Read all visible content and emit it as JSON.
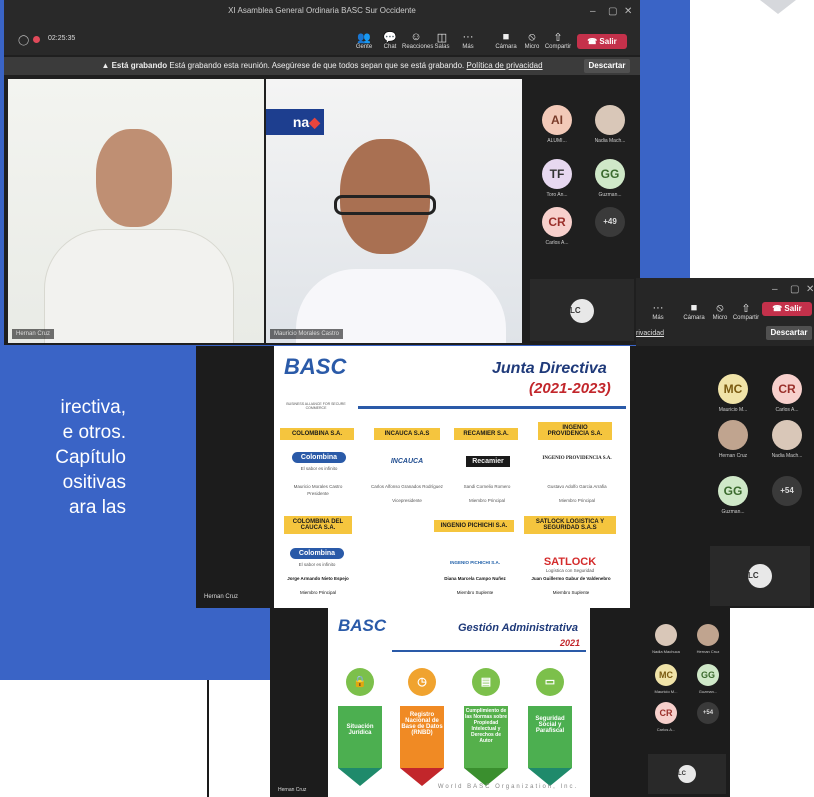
{
  "meeting": {
    "title": "XI Asamblea General Ordinaria BASC Sur Occidente",
    "timer": "02:25:35",
    "tools": [
      "Gente",
      "Chat",
      "Reacciones",
      "Salas",
      "Más",
      "Cámara",
      "Micro",
      "Compartir"
    ],
    "leave": "Salir",
    "banner_strong": "Está grabando",
    "banner_text": "Está grabando esta reunión. Asegúrese de que todos sepan que se está grabando.",
    "banner_link": "Política de privacidad",
    "dismiss": "Descartar"
  },
  "win1": {
    "video1_name": "Hernan Cruz",
    "video2_name": "Mauricio Morales Castro",
    "participants": [
      {
        "initials": "AI",
        "label": "ALUMI..."
      },
      {
        "initials": "",
        "label": "Nadia Mach..."
      },
      {
        "initials": "TF",
        "label": "Toro An..."
      },
      {
        "initials": "GG",
        "label": "Guzman..."
      },
      {
        "initials": "CR",
        "label": "Carlos A..."
      },
      {
        "initials": "+49",
        "label": ""
      }
    ],
    "self": "LC"
  },
  "win2": {
    "tools": [
      "Más",
      "Cámara",
      "Micro",
      "Compartir"
    ],
    "leave": "Salir",
    "privacy_fragment": "rivacidad",
    "dismiss": "Descartar",
    "name": "Hernan Cruz",
    "participants": [
      {
        "initials": "MC",
        "label": "Mauricio M..."
      },
      {
        "initials": "CR",
        "label": "Carlos A..."
      },
      {
        "initials": "",
        "label": "Hernan Cruz"
      },
      {
        "initials": "",
        "label": "Nadia Mach..."
      },
      {
        "initials": "GG",
        "label": "Guzman..."
      },
      {
        "initials": "+54",
        "label": ""
      }
    ],
    "self": "LC",
    "slide": {
      "title": "Junta Directiva",
      "years": "(2021-2023)",
      "logo": "BASC",
      "tagline": "BUSINESS ALLIANCE FOR SECURE COMMERCE",
      "companies": [
        {
          "tab": "COLOMBINA S.A.",
          "brand": "Colombina",
          "sub": "El sabor es infinito",
          "person": "Mauricio Morales Castro",
          "role": "Presidente"
        },
        {
          "tab": "INCAUCA S.A.S",
          "brand": "INCAUCA",
          "sub": "",
          "person": "Carlos Alfonso Granados Rodríguez",
          "role": "Vicepresidente"
        },
        {
          "tab": "RECAMIER S.A.",
          "brand": "Recamier",
          "sub": "",
          "person": "Sandi Cornelio Romero",
          "role": "Miembro Principal"
        },
        {
          "tab": "INGENIO PROVIDENCIA S.A.",
          "brand": "INGENIO PROVIDENCIA S.A.",
          "sub": "",
          "person": "Gustavo Adolfo Garcia Arrafia",
          "role": "Miembro Principal"
        },
        {
          "tab": "COLOMBINA DEL CAUCA S.A.",
          "brand": "Colombina",
          "sub": "El sabor es infinito",
          "person": "Jorge Armando Nieto Espejo",
          "role": "Miembro Principal"
        },
        {
          "tab": "INGENIO PICHICHI S.A.",
          "brand": "INGENIO PICHICHI S.A.",
          "sub": "",
          "person": "Diana Marcela Campo Nuñez",
          "role": "Miembro Suplente"
        },
        {
          "tab": "SATLOCK LOGISTICA Y SEGURIDAD S.A.S",
          "brand": "SATLOCK",
          "sub": "Logística con Seguridad",
          "person": "Juan Guillermo Gabur de Valdenebro",
          "role": "Miembro Suplente"
        }
      ]
    }
  },
  "win3": {
    "name": "Hernan Cruz",
    "participants": [
      {
        "initials": "",
        "label": "Nadia Machuca"
      },
      {
        "initials": "",
        "label": "Hernan Cruz"
      },
      {
        "initials": "MC",
        "label": "Mauricio M..."
      },
      {
        "initials": "GG",
        "label": "Guzman..."
      },
      {
        "initials": "CR",
        "label": "Carlos A..."
      },
      {
        "initials": "+54",
        "label": ""
      }
    ],
    "self": "LC",
    "slide": {
      "title": "Gestión Administrativa",
      "year": "2021",
      "logo": "BASC",
      "pillars": [
        "Situación Jurídica",
        "Registro Nacional de Base de Datos (RNBD)",
        "Cumplimiento de las Normas sobre Propiedad Intelectual y Derechos de Autor",
        "Seguridad Social y Parafiscal"
      ],
      "footer": "World BASC Organization, Inc."
    }
  },
  "background": {
    "side_lines": [
      "irectiva,",
      "e otros.",
      "Capítulo",
      "ositivas",
      "ara  las"
    ]
  },
  "colors": {
    "accent": "#3a64c6",
    "leave": "#c4314b",
    "tab": "#f5c53e"
  }
}
